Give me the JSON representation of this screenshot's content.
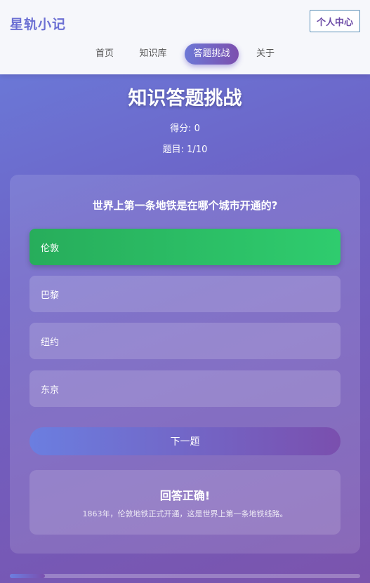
{
  "header": {
    "logo": "星轨小记",
    "profile_button": "个人中心",
    "nav": [
      {
        "label": "首页",
        "active": false
      },
      {
        "label": "知识库",
        "active": false
      },
      {
        "label": "答题挑战",
        "active": true
      },
      {
        "label": "关于",
        "active": false
      }
    ]
  },
  "quiz": {
    "title": "知识答题挑战",
    "score": "得分: 0",
    "progress_label": "题目: 1/10",
    "progress_fraction": 0.1,
    "question": "世界上第一条地铁是在哪个城市开通的?",
    "options": [
      {
        "label": "伦敦",
        "state": "correct"
      },
      {
        "label": "巴黎",
        "state": "normal"
      },
      {
        "label": "纽约",
        "state": "normal"
      },
      {
        "label": "东京",
        "state": "normal"
      }
    ],
    "next_button": "下一题",
    "feedback": {
      "title": "回答正确!",
      "text": "1863年，伦敦地铁正式开通，这是世界上第一条地铁线路。"
    }
  },
  "colors": {
    "accent_start": "#6b7ee0",
    "accent_end": "#7a4fae",
    "correct": "#2fcc6e",
    "logo": "#6b6fd3"
  }
}
